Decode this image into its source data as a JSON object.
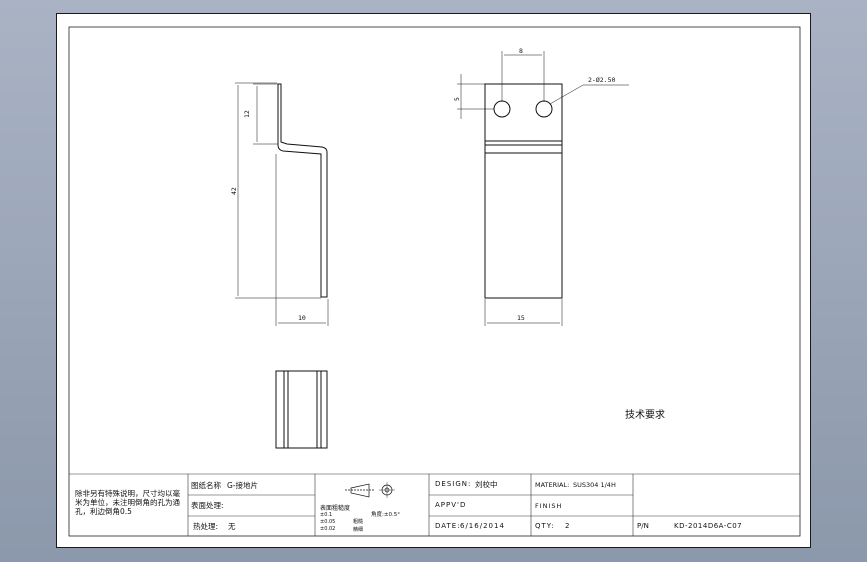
{
  "views": {
    "side": {
      "dim_top_height": "12",
      "dim_total_height": "42",
      "dim_width": "10"
    },
    "front": {
      "dim_hole_spacing": "8",
      "dim_hole_offset": "5",
      "hole_callout": "2-Ø2.50",
      "dim_width": "15"
    }
  },
  "technical_requirements": "技术要求",
  "title_block": {
    "notes": "除非另有特殊说明，尺寸均以毫米为单位，未注明倒角的孔为通孔，利边倒角0.5",
    "drawing_name_label": "图纸名称",
    "drawing_name_value": "G-接地片",
    "surface_treatment_label": "表面处理:",
    "heat_treatment_label": "热处理:",
    "heat_treatment_value": "无",
    "roughness_label": "表面粗糙度",
    "roughness_lines": [
      "±0.1",
      "±0.05",
      "±0.02"
    ],
    "roughness_marks": [
      "粗糙",
      "精细"
    ],
    "angle_label": "角度:±0.5°",
    "design_label": "DESIGN:",
    "design_value": "刘校中",
    "approved_label": "APPV'D",
    "date_label": "DATE:",
    "date_value": "6/16/2014",
    "material_label": "MATERIAL:",
    "material_value": "SUS304 1/4H",
    "finish_label": "FINISH",
    "qty_label": "QTY:",
    "qty_value": "2",
    "pn_label": "P/N",
    "pn_value": "KD-2014D6A-C07"
  }
}
